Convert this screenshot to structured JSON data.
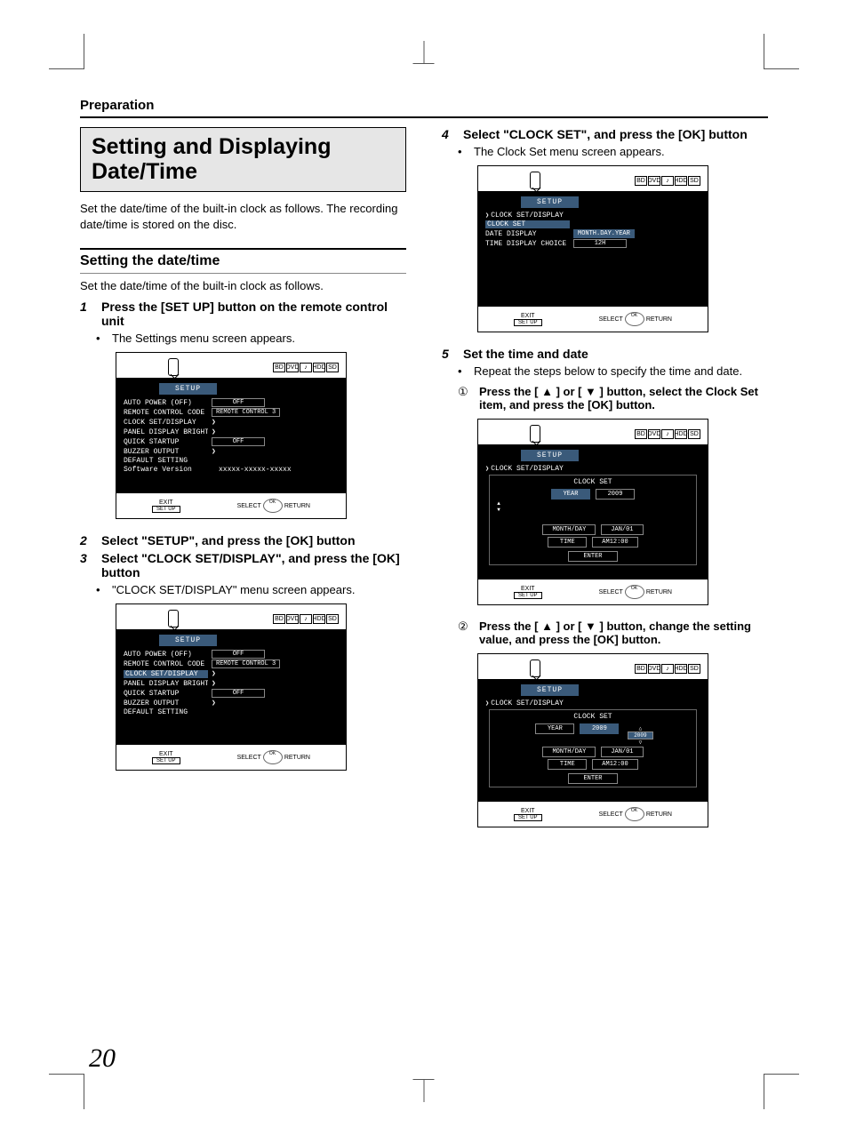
{
  "section": "Preparation",
  "title": "Setting and Displaying Date/Time",
  "intro": "Set the date/time of the built-in clock as follows. The recording date/time is stored on the disc.",
  "subhead": "Setting the date/time",
  "subdesc": "Set the date/time of the built-in clock as follows.",
  "steps": {
    "s1": "Press the [SET UP] button on the remote control unit",
    "s1_bullet": "The Settings menu screen appears.",
    "s2": "Select \"SETUP\", and press the [OK] button",
    "s3": "Select \"CLOCK SET/DISPLAY\", and press the [OK] button",
    "s3_bullet": "\"CLOCK SET/DISPLAY\" menu screen appears.",
    "s4": "Select \"CLOCK SET\", and press the [OK] button",
    "s4_bullet": "The Clock Set menu screen appears.",
    "s5": "Set the time and date",
    "s5_bullet": "Repeat the steps below to specify the time and date.",
    "s5a": "Press the [ ▲ ] or [ ▼ ] button, select the Clock Set item, and press the [OK] button.",
    "s5b": "Press the [ ▲ ] or [ ▼ ] button, change the setting value, and press the [OK] button."
  },
  "nums": {
    "n1": "1",
    "n2": "2",
    "n3": "3",
    "n4": "4",
    "n5": "5",
    "c1": "①",
    "c2": "②"
  },
  "osd": {
    "tab": "SETUP",
    "rows_main": [
      {
        "label": "AUTO POWER (OFF)",
        "val": "OFF"
      },
      {
        "label": "REMOTE CONTROL CODE",
        "val": "REMOTE CONTROL 3"
      },
      {
        "label": "CLOCK SET/DISPLAY",
        "arrow": true
      },
      {
        "label": "PANEL DISPLAY BRIGHTNESS",
        "arrow": true
      },
      {
        "label": "QUICK STARTUP",
        "val": "OFF"
      },
      {
        "label": "BUZZER OUTPUT",
        "arrow": true
      },
      {
        "label": "DEFAULT SETTING"
      },
      {
        "label": "Software Version",
        "plain": "xxxxx-xxxxx-xxxxx"
      }
    ],
    "crumb1": "CLOCK SET/DISPLAY",
    "clock_rows": [
      {
        "label": "CLOCK SET",
        "hl": true
      },
      {
        "label": "DATE DISPLAY",
        "val": "MONTH.DAY.YEAR",
        "valhl": true
      },
      {
        "label": "TIME DISPLAY CHOICE",
        "val": "12H"
      }
    ],
    "clockset_title": "CLOCK SET",
    "fields": {
      "year_l": "YEAR",
      "year_v": "2009",
      "md_l": "MONTH/DAY",
      "md_v": "JAN/01",
      "time_l": "TIME",
      "time_v": "AM12:00",
      "enter": "ENTER"
    },
    "adjust_val": "2009",
    "footer": {
      "exit": "EXIT",
      "setup": "SET UP",
      "select": "SELECT",
      "ret": "RETURN"
    }
  },
  "page_number": "20"
}
